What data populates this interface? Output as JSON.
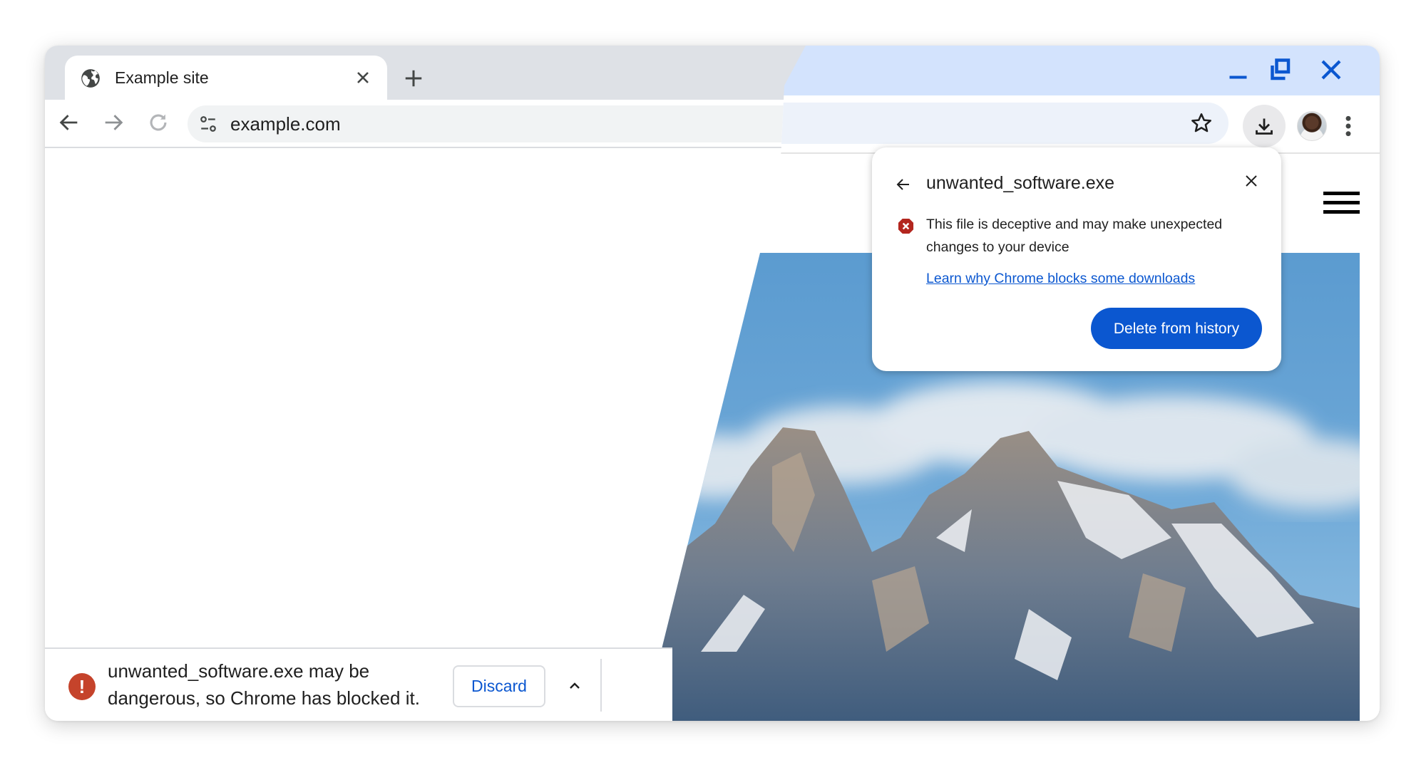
{
  "browser": {
    "tab": {
      "title": "Example site",
      "favicon": "globe-icon"
    },
    "new_tab_icon": "plus-icon",
    "nav": {
      "back": "arrow-left-icon",
      "forward": "arrow-right-icon",
      "reload": "reload-icon"
    },
    "omnibox": {
      "url": "example.com",
      "site_info_icon": "tune-icon",
      "bookmark_icon": "star-icon"
    },
    "window_controls": {
      "minimize": "minimize-icon",
      "restore": "restore-icon",
      "close": "close-icon"
    },
    "toolbar_icons": {
      "downloads": "download-icon",
      "profile": "avatar",
      "menu": "kebab-menu-icon"
    }
  },
  "page": {
    "menu_icon": "hamburger-icon",
    "hero_image": "mountain-photo"
  },
  "download_bubble": {
    "filename": "unwanted_software.exe",
    "message": "This file is deceptive and may make unexpected changes to your device",
    "link": "Learn why Chrome blocks some downloads",
    "primary_button": "Delete from history",
    "colors": {
      "accent": "#0b57d0",
      "danger": "#b3261e"
    }
  },
  "download_shelf": {
    "message": "unwanted_software.exe may be dangerous, so Chrome has blocked it.",
    "discard_button": "Discard",
    "expand_icon": "chevron-up-icon",
    "colors": {
      "warning": "#c5432b",
      "link": "#0b57d0"
    }
  }
}
